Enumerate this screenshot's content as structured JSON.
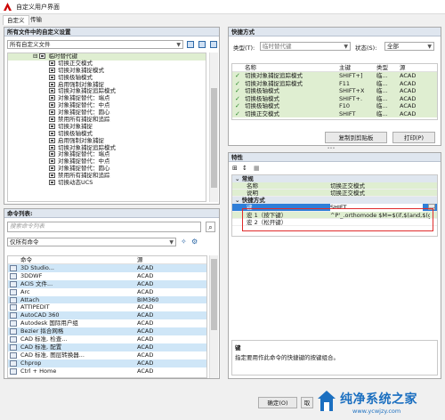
{
  "window": {
    "title": "自定义用户界面"
  },
  "tabs": [
    "自定义",
    "传输"
  ],
  "left_panel": {
    "header": "所有文件中的自定义设置",
    "file_combo": "所有自定义文件",
    "tree": {
      "parent": "临时替代键",
      "items": [
        "切换正交模式",
        "切换对象捕捉模式",
        "切换极轴模式",
        "启用强制对象捕捉",
        "切换对象捕捉追踪模式",
        "对象捕捉替代：端点",
        "对象捕捉替代：中点",
        "对象捕捉替代：圆心",
        "禁用所有捕捉和追踪",
        "切换对象捕捉",
        "切换极轴模式",
        "启用强制对象捕捉",
        "切换对象捕捉追踪模式",
        "对象捕捉替代：端点",
        "对象捕捉替代：中点",
        "对象捕捉替代：圆心",
        "禁用所有捕捉和追踪",
        "切换动态UCS"
      ]
    }
  },
  "commands": {
    "header": "命令列表:",
    "search_placeholder": "搜索命令列表",
    "filter_combo": "仅所有命令",
    "columns": [
      "命令",
      "源"
    ],
    "rows": [
      [
        "3D Studio...",
        "ACAD"
      ],
      [
        "3DDWF",
        "ACAD"
      ],
      [
        "ACIS 文件...",
        "ACAD"
      ],
      [
        "Arc",
        "ACAD"
      ],
      [
        "Attach",
        "BIM360"
      ],
      [
        "ATTIPEDIT",
        "ACAD"
      ],
      [
        "AutoCAD 360",
        "ACAD"
      ],
      [
        "Autodesk 国际用户组",
        "ACAD"
      ],
      [
        "Bezier 拟合网格",
        "ACAD"
      ],
      [
        "CAD 标准, 检查...",
        "ACAD"
      ],
      [
        "CAD 标准, 配置",
        "ACAD"
      ],
      [
        "CAD 标准, 图层转换器...",
        "ACAD"
      ],
      [
        "Chprop",
        "ACAD"
      ],
      [
        "Ctrl + Home",
        "ACAD"
      ]
    ]
  },
  "shortcuts": {
    "header": "快捷方式",
    "type_label": "类型(T):",
    "type_value": "临时替代键",
    "status_label": "状态(S):",
    "status_value": "全部",
    "columns": [
      "名称",
      "主键",
      "类型",
      "源"
    ],
    "rows": [
      [
        "切换对象捕捉追踪模式",
        "SHIFT+]",
        "临...",
        "ACAD"
      ],
      [
        "切换对象捕捉追踪模式",
        "F11",
        "临...",
        "ACAD"
      ],
      [
        "切换极轴模式",
        "SHIFT+X",
        "临...",
        "ACAD"
      ],
      [
        "切换极轴模式",
        "SHIFT+.",
        "临...",
        "ACAD"
      ],
      [
        "切换极轴模式",
        "F10",
        "临...",
        "ACAD"
      ],
      [
        "切换正交模式",
        "SHIFT",
        "临...",
        "ACAD"
      ]
    ],
    "copy_button": "复制到剪贴板",
    "print_button": "打印(P)"
  },
  "properties": {
    "header": "特性",
    "group_general": "常规",
    "name_label": "名称",
    "name_value": "切换正交模式",
    "desc_label": "说明",
    "desc_value": "切换正交模式",
    "group_keys": "快捷方式",
    "key_label": "键",
    "key_value": "SHIFT",
    "macro1_label": "宏 1（按下键）",
    "macro1_value": "^P'_.orthomode $M=$(if,$(and,$(get",
    "macro2_label": "宏 2（松开键）",
    "macro2_value": "",
    "desc_title": "键",
    "desc_text": "指定要用作此命令的快捷键的按键组合。"
  },
  "footer": {
    "ok": "确定(O)",
    "cancel": "取"
  },
  "watermark": {
    "brand": "纯净系统之家",
    "url": "www.ycwjzy.com"
  }
}
